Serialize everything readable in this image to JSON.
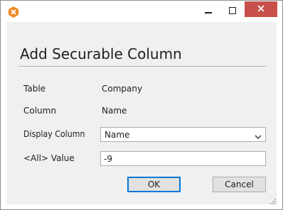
{
  "window": {
    "app_icon": "orange-x-hexagon-icon",
    "controls": {
      "minimize_icon": "minimize-icon",
      "maximize_icon": "maximize-icon",
      "close_icon": "close-icon"
    },
    "colors": {
      "close_button": "#c7504b",
      "client_background": "#f0f0f0",
      "focus_border": "#0078d7"
    }
  },
  "dialog": {
    "title": "Add Securable Column",
    "fields": {
      "table_label": "Table",
      "table_value": "Company",
      "column_label": "Column",
      "column_value": "Name",
      "display_column_label": "Display Column",
      "display_column_value": "Name",
      "all_value_label": "<All> Value",
      "all_value_value": "-9"
    },
    "buttons": {
      "ok": "OK",
      "cancel": "Cancel"
    }
  }
}
